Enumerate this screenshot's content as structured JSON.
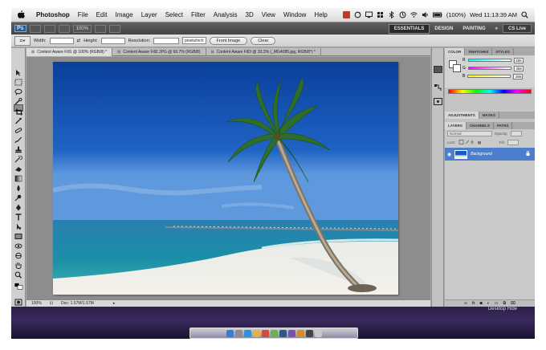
{
  "menubar": {
    "app": "Photoshop",
    "menus": [
      "File",
      "Edit",
      "Image",
      "Layer",
      "Select",
      "Filter",
      "Analysis",
      "3D",
      "View",
      "Window",
      "Help"
    ],
    "battery": "(100%)",
    "clock": "Wed 11:13:39 AM"
  },
  "appbar": {
    "zoom": "100%",
    "workspaces": [
      "ESSENTIALS",
      "DESIGN",
      "PAINTING"
    ],
    "more": "»",
    "cslive": "CS Live"
  },
  "options": {
    "width_label": "Width:",
    "height_label": "Height:",
    "resolution_label": "Resolution:",
    "units": "pixels/inch",
    "front_image": "Front Image",
    "clear": "Clear"
  },
  "doc_tabs": [
    {
      "label": "Content Aware Fill1 @ 100% (RGB/8) *"
    },
    {
      "label": "Content Aware Fill2.JPG @ 66.7% (RGB/8)"
    },
    {
      "label": "Content Aware Fill3 @ 33.3% (_MG4085.jpg, RGB/8*) *"
    }
  ],
  "status": {
    "zoom": "100%",
    "doc": "Doc: 1.57M/1.57M"
  },
  "color_panel": {
    "tabs": [
      "COLOR",
      "SWATCHES",
      "STYLES"
    ],
    "channels": [
      {
        "name": "R",
        "value": "255"
      },
      {
        "name": "G",
        "value": "255"
      },
      {
        "name": "B",
        "value": "255"
      }
    ]
  },
  "adjust_tabs": [
    "ADJUSTMENTS",
    "MASKS"
  ],
  "layers_panel": {
    "tabs": [
      "LAYERS",
      "CHANNELS",
      "PATHS"
    ],
    "blend": "Normal",
    "opacity_label": "Opacity:",
    "lock_label": "Lock:",
    "fill_label": "Fill:",
    "layer_name": "Background"
  },
  "desktop": {
    "hide_label": "Desktop Hide"
  },
  "colors": {
    "accent": "#4b7fce",
    "sky_top": "#0a3f9c",
    "sea": "#1b8fa6",
    "sand": "#f4f1ea"
  }
}
